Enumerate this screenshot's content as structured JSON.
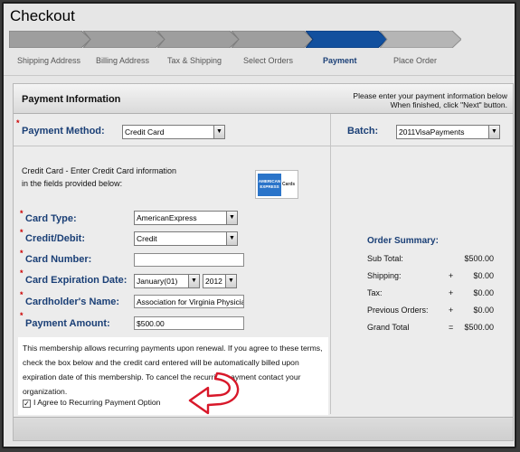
{
  "page": {
    "title": "Checkout"
  },
  "steps": [
    {
      "label": "Shipping Address",
      "active": false
    },
    {
      "label": "Billing Address",
      "active": false
    },
    {
      "label": "Tax & Shipping",
      "active": false
    },
    {
      "label": "Select Orders",
      "active": false
    },
    {
      "label": "Payment",
      "active": true
    },
    {
      "label": "Place Order",
      "active": false
    }
  ],
  "panel": {
    "title": "Payment Information",
    "note_line1": "Please enter your payment information below",
    "note_line2": "When finished, click \"Next\" button."
  },
  "payment_method": {
    "label": "Payment Method:",
    "value": "Credit Card"
  },
  "batch": {
    "label": "Batch:",
    "value": "2011VisaPayments"
  },
  "credit_card": {
    "intro_line1": "Credit Card - Enter Credit Card information",
    "intro_line2": "in the fields provided below:",
    "logo_text": "AMERICAN EXPRESS",
    "logo_cards": "Cards",
    "card_type": {
      "label": "Card Type:",
      "value": "AmericanExpress"
    },
    "credit_debit": {
      "label": "Credit/Debit:",
      "value": "Credit"
    },
    "card_number": {
      "label": "Card Number:",
      "value": ""
    },
    "expiration": {
      "label": "Card Expiration Date:",
      "month": "January(01)",
      "year": "2012"
    },
    "cardholder": {
      "label": "Cardholder's Name:",
      "value": "Association for Virginia Physician"
    },
    "amount": {
      "label": "Payment Amount:",
      "value": "$500.00"
    }
  },
  "recurring": {
    "text": "This membership allows recurring payments upon renewal. If you agree to these terms, check the box below and the credit card entered will be automatically billed upon expiration date of this membership. To cancel the recurring payment contact your organization.",
    "checkbox_label": "I Agree to Recurring Payment Option",
    "checked": true
  },
  "order_summary": {
    "title": "Order Summary:",
    "rows": [
      {
        "label": "Sub Total:",
        "op": "",
        "value": "$500.00"
      },
      {
        "label": "Shipping:",
        "op": "+",
        "value": "$0.00"
      },
      {
        "label": "Tax:",
        "op": "+",
        "value": "$0.00"
      },
      {
        "label": "Previous Orders:",
        "op": "+",
        "value": "$0.00"
      },
      {
        "label": "Grand Total",
        "op": "=",
        "value": "$500.00"
      }
    ]
  },
  "colors": {
    "accent": "#1a3f76",
    "active_step": "#12509e",
    "required": "#cc0000"
  }
}
